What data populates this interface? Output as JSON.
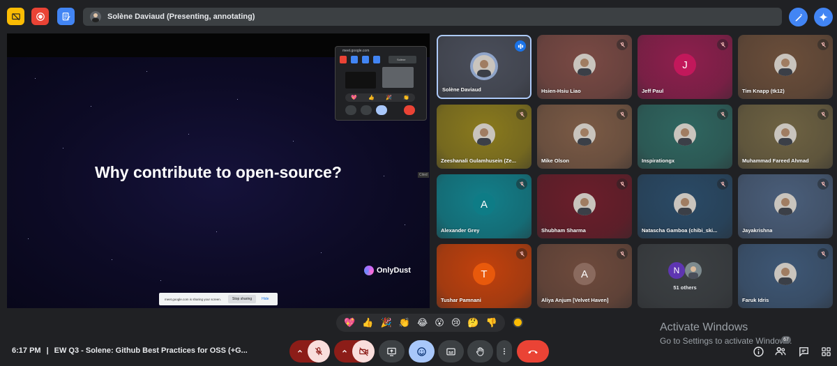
{
  "header": {
    "presenter_label": "Solène Daviaud (Presenting, annotating)"
  },
  "presentation": {
    "slide_title": "Why contribute to open-source?",
    "brand_name": "OnlyDust",
    "cited_tag": "Cited",
    "mini_window_url": "meet.google.com",
    "mini_window_name": "Solène",
    "share_notice": "meet.google.com is sharing your screen.",
    "stop_sharing_label": "Stop sharing",
    "hide_label": "Hide"
  },
  "participants": [
    {
      "name": "Solène Daviaud",
      "initial": "",
      "speaking": true,
      "bg": "#4a4e5a"
    },
    {
      "name": "Hsien-Hsiu Liao",
      "initial": "",
      "speaking": false,
      "bg": "#7a4a44"
    },
    {
      "name": "Jeff Paul",
      "initial": "J",
      "speaking": false,
      "bg": "#8e1f4d",
      "avatar_color": "#c2185b"
    },
    {
      "name": "Tim Knapp (tk12)",
      "initial": "",
      "speaking": false,
      "bg": "#6b4e3a"
    },
    {
      "name": "Zeeshanali Gulamhusein (Ze...",
      "initial": "",
      "speaking": false,
      "bg": "#8a7a1e"
    },
    {
      "name": "Mike Olson",
      "initial": "",
      "speaking": false,
      "bg": "#7b5a45"
    },
    {
      "name": "Inspirationgx",
      "initial": "",
      "speaking": false,
      "bg": "#2f6660"
    },
    {
      "name": "Muhammad Fareed Ahmad",
      "initial": "",
      "speaking": false,
      "bg": "#6e6242"
    },
    {
      "name": "Alexander Grey",
      "initial": "A",
      "speaking": false,
      "bg": "#127f8a",
      "avatar_color": "#0e7c86"
    },
    {
      "name": "Shubham Sharma",
      "initial": "",
      "speaking": false,
      "bg": "#6b1e2a"
    },
    {
      "name": "Natascha Gamboa (chibi_ski...",
      "initial": "",
      "speaking": false,
      "bg": "#2a4a66"
    },
    {
      "name": "Jayakrishna",
      "initial": "",
      "speaking": false,
      "bg": "#4a5e7a"
    },
    {
      "name": "Tushar Pamnani",
      "initial": "T",
      "speaking": false,
      "bg": "#c2410c",
      "avatar_color": "#e8590c"
    },
    {
      "name": "Aliya Anjum [Velvet Haven]",
      "initial": "A",
      "speaking": false,
      "bg": "#6e4a3c",
      "avatar_color": "#8a6a5e"
    },
    {
      "name": "51 others",
      "initial": "N",
      "speaking": false,
      "bg": "#3c4043",
      "avatar_color": "#5e35b1",
      "others": true
    },
    {
      "name": "Faruk Idris",
      "initial": "",
      "speaking": false,
      "bg": "#3e5775"
    }
  ],
  "reactions": [
    "💖",
    "👍",
    "🎉",
    "👏",
    "😂",
    "😮",
    "😢",
    "🤔",
    "👎"
  ],
  "footer": {
    "time": "6:17 PM",
    "separator": "|",
    "meeting_name": "EW Q3 - Solene: Github Best Practices for OSS (+G...",
    "people_count": "67"
  },
  "watermark": {
    "line1": "Activate Windows",
    "line2": "Go to Settings to activate Windows."
  },
  "colors": {
    "accent": "#4285f4",
    "danger": "#ea4335",
    "dark_red": "#8c1d18",
    "active_blue": "#a8c7fa"
  }
}
